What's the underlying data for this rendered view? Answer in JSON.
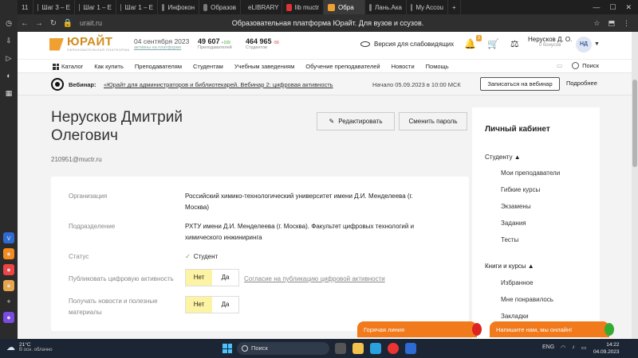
{
  "browser": {
    "tabs": [
      {
        "label": "11",
        "color": "#888"
      },
      {
        "label": "Шаг 3 – Е",
        "color": "#7a7a7a"
      },
      {
        "label": "Шаг 1 – Е",
        "color": "#7a7a7a"
      },
      {
        "label": "Шаг 1 – Е",
        "color": "#7a7a7a"
      },
      {
        "label": "Инфокон",
        "color": "#7a7a7a"
      },
      {
        "label": "Образов",
        "color": "#7a7a7a"
      },
      {
        "label": "eLIBRARY",
        "color": "#e05a2b"
      },
      {
        "label": "lib muctr",
        "color": "#d33"
      },
      {
        "label": "Обра",
        "color": "#f0a030",
        "active": true
      },
      {
        "label": "Лань.Ака",
        "color": "#7a7a7a"
      },
      {
        "label": "My Accou",
        "color": "#7a7a7a"
      }
    ],
    "url": "urait.ru",
    "page_title": "Образовательная платформа Юрайт. Для вузов и ссузов.",
    "win_min": "—",
    "win_max": "☐",
    "win_close": "✕"
  },
  "header": {
    "logo_text": "ЮРАЙТ",
    "logo_sub": "образовательная платформа",
    "date": "04 сентября 2023",
    "date_sub": "активны на платформе",
    "teachers_num": "49 607",
    "teachers_delta": "+109",
    "teachers_label": "Преподавателей",
    "students_num": "464 965",
    "students_delta": "-56",
    "students_label": "Студентов",
    "vision_label": "Версия для слабовидящих",
    "notif_count": "3",
    "user_name": "Нерусков Д. О.",
    "user_bonus": "0 бонусов",
    "avatar": "НД"
  },
  "menu": {
    "items": [
      "Каталог",
      "Как купить",
      "Преподавателям",
      "Студентам",
      "Учебным заведениям",
      "Обучение преподавателей",
      "Новости",
      "Помощь"
    ],
    "search": "Поиск"
  },
  "webinar": {
    "label": "Вебинар:",
    "link": "«Юрайт для администраторов и библиотекарей. Вебинар 2: цифровая активность",
    "date": "Начало 05.09.2023 в 10:00 МСК",
    "button": "Записаться на вебинар",
    "more": "Подробнее"
  },
  "profile": {
    "name_line1": "Нерусков Дмитрий",
    "name_line2": "Олегович",
    "email": "210951@muctr.ru",
    "edit": "Редактировать",
    "change_password": "Сменить пароль",
    "org_label": "Организация",
    "org_value": "Российский химико-технологический университет имени Д.И. Менделеева (г. Москва)",
    "dept_label": "Подразделение",
    "dept_value": "РХТУ имени Д.И. Менделеева (г. Москва). Факультет цифровых технологий и химического инжиниринга",
    "status_label": "Статус",
    "status_value": "Студент",
    "publish_label": "Публиковать цифровую активность",
    "publish_no": "Нет",
    "publish_yes": "Да",
    "consent": "Согласие на публикацию цифровой активности",
    "news_label": "Получать новости и полезные материалы",
    "news_no": "Нет",
    "news_yes": "Да"
  },
  "sidebar": {
    "title": "Личный кабинет",
    "group1": "Студенту",
    "group1_items": [
      "Мои преподаватели",
      "Гибкие курсы",
      "Экзамены",
      "Задания",
      "Тесты"
    ],
    "group2": "Книги и курсы",
    "group2_items": [
      "Избранное",
      "Мне понравилось",
      "Закладки"
    ]
  },
  "chat": {
    "hotline": "Горячая линия",
    "online": "Напишите нам, мы онлайн!"
  },
  "taskbar": {
    "temp": "21°C",
    "weather": "В осн. облачно",
    "search": "Поиск",
    "lang": "ENG",
    "time": "14:22",
    "date": "04.09.2023"
  }
}
